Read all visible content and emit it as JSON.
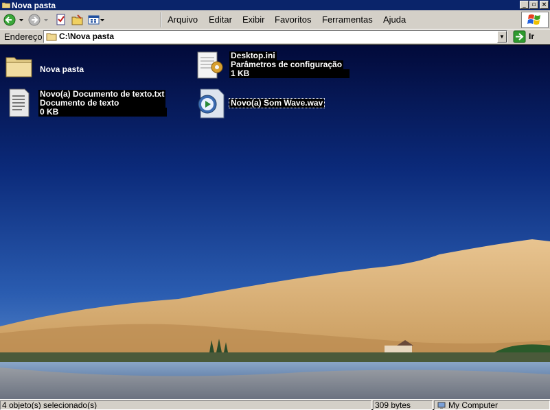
{
  "window": {
    "title": "Nova pasta",
    "controls": {
      "minimize": "_",
      "restore": "▫",
      "close": "×"
    }
  },
  "menu": [
    "Arquivo",
    "Editar",
    "Exibir",
    "Favoritos",
    "Ferramentas",
    "Ajuda"
  ],
  "address": {
    "label": "Endereço",
    "value": "C:\\Nova pasta",
    "go_label": "Ir"
  },
  "files": [
    {
      "name": "Nova pasta",
      "type": "folder-icon"
    },
    {
      "name": "Desktop.ini",
      "desc": "Parâmetros de configuração",
      "size": "1 KB",
      "type": "settings-file-icon"
    },
    {
      "name": "Novo(a) Documento de texto.txt",
      "desc": "Documento de texto",
      "size": "0 KB",
      "type": "text-document-icon"
    },
    {
      "name": "Novo(a) Som Wave.wav",
      "type": "media-file-icon"
    }
  ],
  "status": {
    "selection": "4 objeto(s) selecionado(s)",
    "size": "309 bytes",
    "zone": "My Computer"
  },
  "colors": {
    "titlebar": "#0a246a",
    "chrome": "#d4d0c8",
    "sky_top": "#020a3a",
    "sky_bottom": "#3a6fc0",
    "sand": "#d8b47c"
  }
}
